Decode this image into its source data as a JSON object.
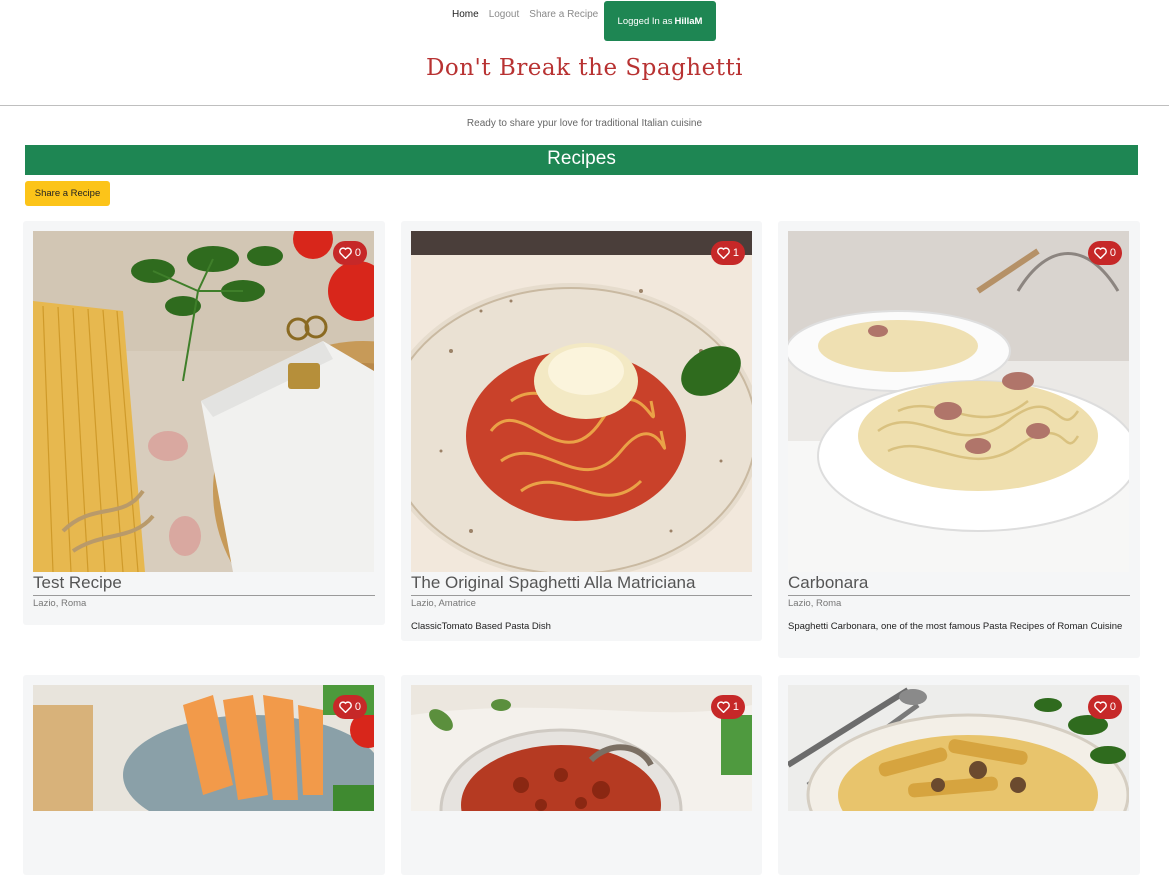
{
  "nav": {
    "home": "Home",
    "logout": "Logout",
    "share": "Share a Recipe",
    "login_prefix": "Logged In as",
    "username": "HillaM"
  },
  "site_title": "Don't Break the Spaghetti",
  "tagline": "Ready to share ypur love for traditional Italian cuisine",
  "section_title": "Recipes",
  "share_button": "Share a Recipe",
  "colors": {
    "brand_green": "#1e8653",
    "title_red": "#b83232",
    "like_red": "#c62828",
    "button_yellow": "#fcc419"
  },
  "recipes": [
    {
      "title": "Test Recipe",
      "location": "Lazio, Roma",
      "description": "",
      "likes": "0"
    },
    {
      "title": "The Original Spaghetti Alla Matriciana",
      "location": "Lazio, Amatrice",
      "description": "ClassicTomato Based Pasta Dish",
      "likes": "1"
    },
    {
      "title": "Carbonara",
      "location": "Lazio, Roma",
      "description": "Spaghetti Carbonara, one of the most famous Pasta Recipes of Roman Cuisine",
      "likes": "0"
    },
    {
      "title": "",
      "location": "",
      "description": "",
      "likes": "0"
    },
    {
      "title": "",
      "location": "",
      "description": "",
      "likes": "1"
    },
    {
      "title": "",
      "location": "",
      "description": "",
      "likes": "0"
    }
  ]
}
